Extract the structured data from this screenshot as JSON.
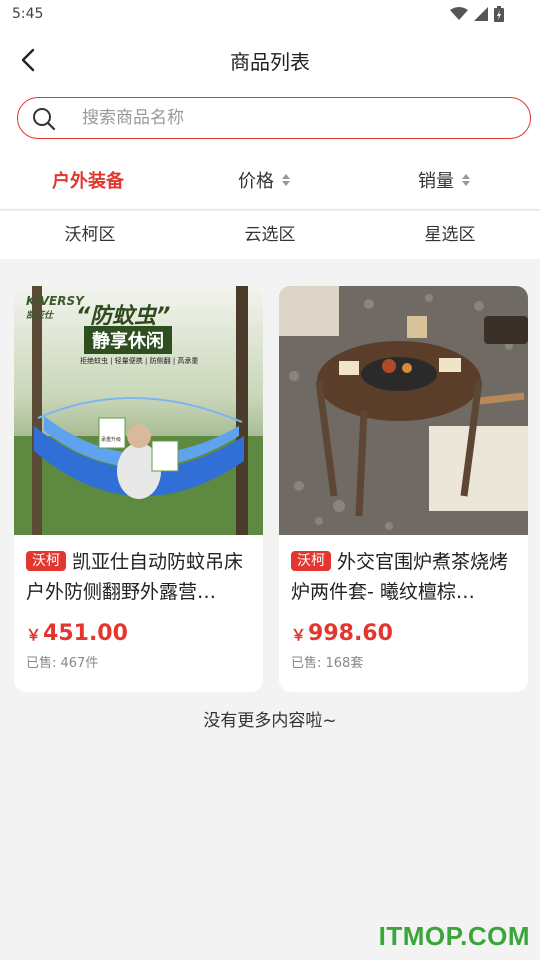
{
  "status_bar": {
    "time": "5:45"
  },
  "header": {
    "title": "商品列表"
  },
  "search": {
    "placeholder": "搜索商品名称",
    "value": ""
  },
  "sort": {
    "items": [
      {
        "label": "户外装备",
        "active": true
      },
      {
        "label": "价格",
        "active": false
      },
      {
        "label": "销量",
        "active": false
      }
    ]
  },
  "zones": {
    "items": [
      "沃柯区",
      "云选区",
      "星选区"
    ]
  },
  "products": [
    {
      "tag": "沃柯",
      "title": "凯亚仕自动防蚊吊床户外防侧翻野外露营…",
      "currency": "￥",
      "price": "451.00",
      "sold": "已售: 467件",
      "image_texts": {
        "brand": "KIVERSY",
        "brand_cn": "凯亚仕",
        "headline": "“防蚊虫”",
        "subline": "静享休闲",
        "features": "拒绝蚊虫 | 轻量便携 | 防侧翻 | 高承重",
        "badge": "承重升级"
      }
    },
    {
      "tag": "沃柯",
      "title": "外交官围炉煮茶烧烤炉两件套- 曦纹檀棕…",
      "currency": "￥",
      "price": "998.60",
      "sold": "已售: 168套"
    }
  ],
  "footer": {
    "no_more": "没有更多内容啦~"
  },
  "watermark": "ITMOP.COM",
  "colors": {
    "accent": "#e2362f",
    "background": "#f3f3f3",
    "watermark": "#3aa63a"
  }
}
